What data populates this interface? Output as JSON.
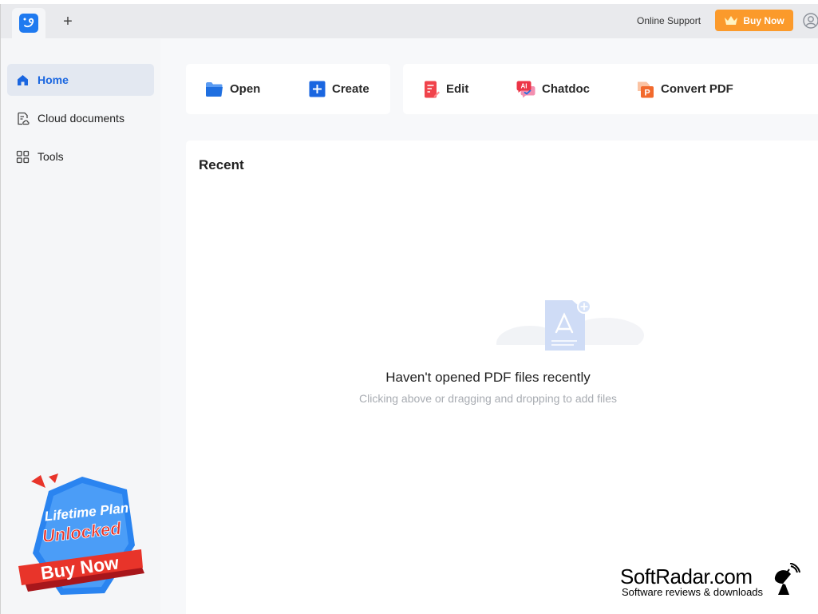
{
  "titlebar": {
    "new_tab_label": "+",
    "online_support": "Online Support",
    "buy_now": "Buy Now"
  },
  "sidebar": {
    "items": [
      {
        "label": "Home",
        "icon": "home-icon",
        "active": true
      },
      {
        "label": "Cloud documents",
        "icon": "cloud-document-icon",
        "active": false
      },
      {
        "label": "Tools",
        "icon": "tools-grid-icon",
        "active": false
      }
    ],
    "promo": {
      "line1": "Lifetime Plan",
      "line2": "Unlocked",
      "button": "Buy Now"
    }
  },
  "actions": {
    "open": "Open",
    "create": "Create",
    "edit": "Edit",
    "chatdoc": "Chatdoc",
    "chatdoc_badge": "AI",
    "convert": "Convert PDF",
    "convert_badge": "P"
  },
  "recent": {
    "title": "Recent",
    "empty_title": "Haven't opened PDF files recently",
    "empty_subtitle": "Clicking above or dragging and dropping to add files"
  },
  "watermark": {
    "title": "SoftRadar.com",
    "subtitle": "Software reviews & downloads"
  },
  "colors": {
    "accent": "#1a66e0",
    "buy": "#fb9a2b",
    "promo_red": "#e8342a",
    "promo_blue": "#2a84f0"
  }
}
